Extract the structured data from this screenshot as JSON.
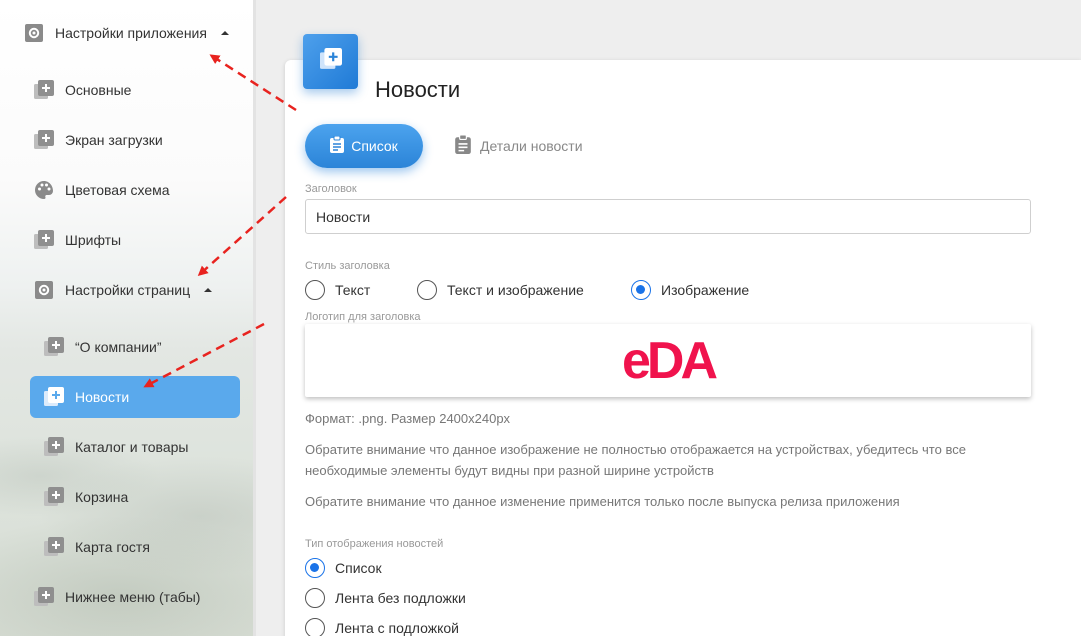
{
  "sidebar": {
    "items": [
      {
        "label": "Настройки приложения",
        "icon": "gear-icon"
      },
      {
        "label": "Основные",
        "icon": "add-box-icon"
      },
      {
        "label": "Экран загрузки",
        "icon": "add-box-icon"
      },
      {
        "label": "Цветовая схема",
        "icon": "palette-icon"
      },
      {
        "label": "Шрифты",
        "icon": "add-box-icon"
      },
      {
        "label": "Настройки страниц",
        "icon": "gear-icon"
      },
      {
        "label": "“О компании”",
        "icon": "add-box-icon"
      },
      {
        "label": "Новости",
        "icon": "add-box-icon"
      },
      {
        "label": "Каталог и товары",
        "icon": "add-box-icon"
      },
      {
        "label": "Корзина",
        "icon": "add-box-icon"
      },
      {
        "label": "Карта гостя",
        "icon": "add-box-icon"
      },
      {
        "label": "Нижнее меню (табы)",
        "icon": "add-box-icon"
      }
    ],
    "active_color": "#5aa9ec"
  },
  "main": {
    "title": "Новости",
    "tabs": [
      {
        "label": "Список",
        "icon": "clipboard-icon",
        "active": true
      },
      {
        "label": "Детали новости",
        "icon": "clipboard-icon",
        "active": false
      }
    ],
    "heading_field": {
      "label": "Заголовок",
      "value": "Новости"
    },
    "heading_style": {
      "label": "Стиль заголовка",
      "options": [
        "Текст",
        "Текст и изображение",
        "Изображение"
      ],
      "selected": "Изображение"
    },
    "logo": {
      "label": "Логотип для заголовка",
      "text": "eDA",
      "color": "#f0134d"
    },
    "format_note": "Формат: .png. Размер 2400x240px",
    "notice_1_line1": "Обратите внимание что данное изображение не полностью отображается на устройствах, убедитесь что все",
    "notice_1_line2": "необходимые элементы будут видны при разной ширине устройств",
    "notice_2": "Обратите внимание что данное изменение применится только после выпуска релиза приложения",
    "display_type": {
      "label": "Тип отображения новостей",
      "options": [
        "Список",
        "Лента без подложки",
        "Лента с подложкой"
      ],
      "selected": "Список"
    }
  },
  "colors": {
    "accent": "#1a73e8",
    "arrow": "#e8231f"
  }
}
